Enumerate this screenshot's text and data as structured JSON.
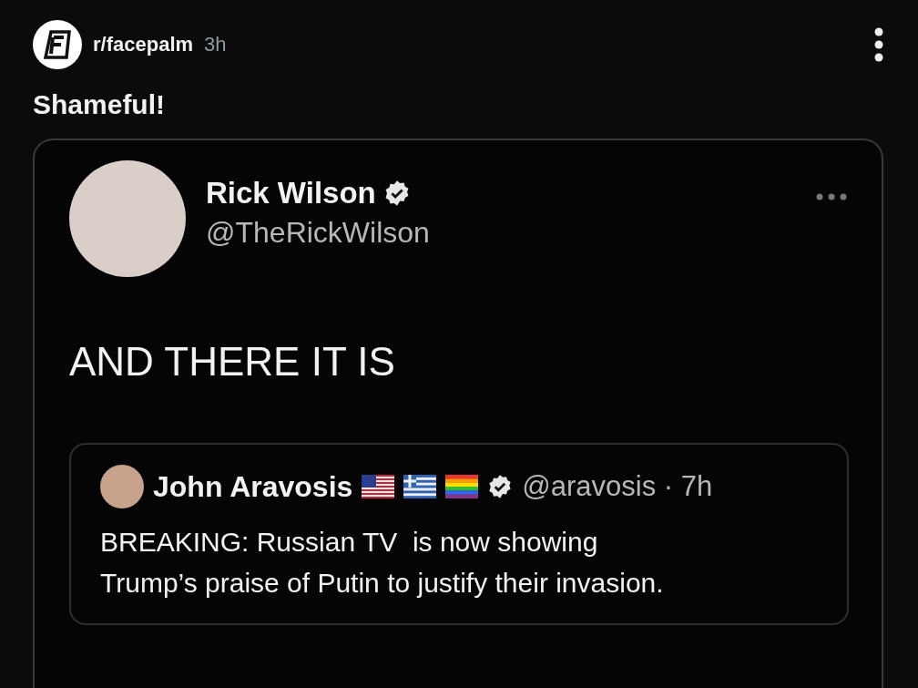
{
  "post": {
    "subreddit": "r/facepalm",
    "age": "3h",
    "title": "Shameful!"
  },
  "tweet": {
    "author": "Rick Wilson",
    "verified": true,
    "handle": "@TheRickWilson",
    "text": "AND THERE IT IS",
    "quote": {
      "author": "John Aravosis",
      "verified": true,
      "meta": "@aravosis · 7h",
      "text": "BREAKING: Russian TV  is now showing\nTrump’s praise of Putin to justify their invasion."
    }
  }
}
